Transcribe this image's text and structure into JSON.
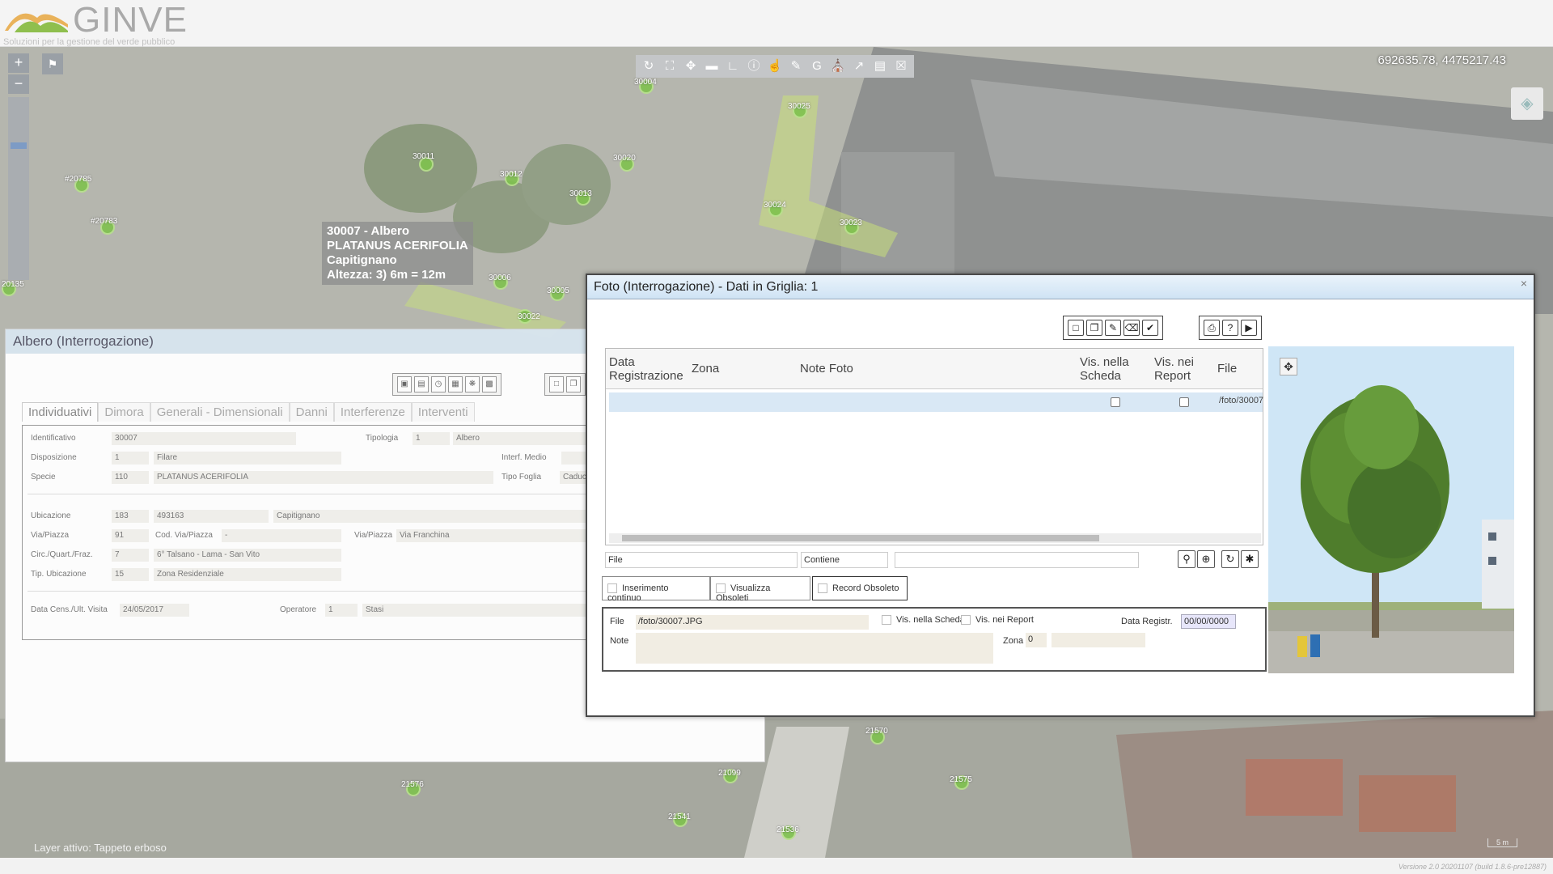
{
  "app": {
    "brand": "GINVE",
    "tagline": "Soluzioni per la gestione del verde pubblico"
  },
  "map": {
    "coords": "692635.78, 4475217.43",
    "layer_info": "Layer attivo: Tappeto erboso",
    "version": "Versione 2.0 20201107 (build 1.8.6-pre12887)",
    "scale": "5 m",
    "markers": [
      "30004",
      "30025",
      "30011",
      "30020",
      "30012",
      "30013",
      "30024",
      "30023",
      "#20785",
      "#20783",
      "30006",
      "30005",
      "30022",
      "21570",
      "21099",
      "21575",
      "21576",
      "21541",
      "21536",
      "20135"
    ],
    "tooltip": [
      "30007 - Albero",
      "PLATANUS ACERIFOLIA",
      "Capitignano",
      "Altezza: 3) 6m = 12m"
    ]
  },
  "albero": {
    "title": "Albero (Interrogazione)",
    "tabs": [
      "Individuativi",
      "Dimora",
      "Generali - Dimensionali",
      "Danni",
      "Interferenze",
      "Interventi"
    ],
    "fields": {
      "identificativo_label": "Identificativo",
      "identificativo": "30007",
      "tipologia_label": "Tipologia",
      "tipologia_code": "1",
      "tipologia": "Albero",
      "disposizione_label": "Disposizione",
      "disposizione_code": "1",
      "disposizione": "Filare",
      "interf_label": "Interf. Medio",
      "specie_label": "Specie",
      "specie_code": "110",
      "specie": "PLATANUS ACERIFOLIA",
      "tipo_foglia_label": "Tipo Foglia",
      "tipo_foglia": "Caduca",
      "ubicazione_label": "Ubicazione",
      "ubicazione_code": "183",
      "ubicazione_num": "493163",
      "ubicazione": "Capitignano",
      "via_label": "Via/Piazza",
      "via_code": "91",
      "cod_via": "Cod. Via/Piazza",
      "cod_via_val": "-",
      "via2_label": "Via/Piazza",
      "via": "Via Franchina",
      "circ_label": "Circ./Quart./Fraz.",
      "circ_code": "7",
      "circ": "6° Talsano - Lama - San Vito",
      "tip_ubic_label": "Tip. Ubicazione",
      "tip_ubic_code": "15",
      "tip_ubic": "Zona Residenziale",
      "data_label": "Data Cens./Ult. Visita",
      "data": "24/05/2017",
      "operatore_label": "Operatore",
      "operatore_code": "1",
      "operatore": "Stasi"
    }
  },
  "foto": {
    "title": "Foto (Interrogazione) - Dati in Griglia: 1",
    "close": "×",
    "columns": {
      "data": "Data Registrazione",
      "zona": "Zona",
      "note": "Note Foto",
      "vis_scheda": "Vis. nella Scheda",
      "vis_report": "Vis. nei Report",
      "file": "File"
    },
    "row": {
      "file": "/foto/30007"
    },
    "filter": {
      "field": "File",
      "op": "Contiene",
      "value": ""
    },
    "options": {
      "inserimento": "Inserimento continuo",
      "obsoleti": "Visualizza Obsoleti",
      "record_obsoleto": "Record Obsoleto"
    },
    "detail": {
      "file_label": "File",
      "file": "/foto/30007.JPG",
      "vis_scheda": "Vis. nella Scheda",
      "vis_report": "Vis. nei Report",
      "data_label": "Data Registr.",
      "data": "00/00/0000",
      "note_label": "Note",
      "note": "",
      "zona_label": "Zona",
      "zona": "0"
    }
  },
  "colors": {
    "map_bg": "#b4b5ad",
    "title_blue": "#cfe3f4",
    "marker_green": "#7fc24e"
  }
}
